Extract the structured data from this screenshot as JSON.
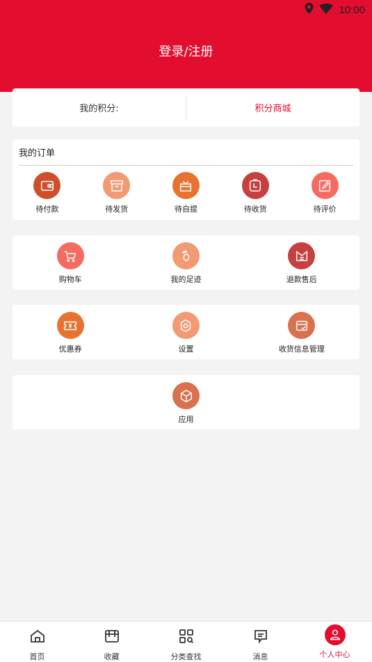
{
  "status_bar": {
    "time": "10:00",
    "icons": [
      "location-icon",
      "wifi-icon"
    ]
  },
  "header": {
    "login_label": "登录/注册",
    "bg_color": "#e30d2f"
  },
  "points": {
    "my_points_label": "我的积分:",
    "mall_label": "积分商城"
  },
  "orders": {
    "title": "我的订单",
    "items": [
      {
        "label": "待付款",
        "icon": "wallet-icon",
        "color": "#cf4f2a"
      },
      {
        "label": "待发货",
        "icon": "box-icon",
        "color": "#f19a74"
      },
      {
        "label": "待自提",
        "icon": "gift-icon",
        "color": "#e8722f"
      },
      {
        "label": "待收货",
        "icon": "clock-package-icon",
        "color": "#c64040"
      },
      {
        "label": "待评价",
        "icon": "edit-icon",
        "color": "#f56b62"
      }
    ]
  },
  "services": {
    "row1": [
      {
        "label": "购物车",
        "icon": "cart-icon",
        "color": "#f56b62"
      },
      {
        "label": "我的足迹",
        "icon": "footprint-icon",
        "color": "#f19a74"
      },
      {
        "label": "退款售后",
        "icon": "refund-icon",
        "color": "#c64040"
      }
    ],
    "row2": [
      {
        "label": "优惠券",
        "icon": "coupon-icon",
        "color": "#e8722f"
      },
      {
        "label": "设置",
        "icon": "settings-icon",
        "color": "#f19a74"
      },
      {
        "label": "收货信息管理",
        "icon": "address-icon",
        "color": "#d9714f"
      }
    ],
    "row3": [
      {
        "label": "应用",
        "icon": "app-cube-icon",
        "color": "#d9714f"
      }
    ]
  },
  "tabbar": {
    "items": [
      {
        "label": "首页",
        "icon": "home-icon"
      },
      {
        "label": "收藏",
        "icon": "store-icon"
      },
      {
        "label": "分类查找",
        "icon": "category-search-icon"
      },
      {
        "label": "消息",
        "icon": "message-icon"
      },
      {
        "label": "个人中心",
        "icon": "user-icon",
        "active": true
      }
    ],
    "active_color": "#e30d2f"
  }
}
